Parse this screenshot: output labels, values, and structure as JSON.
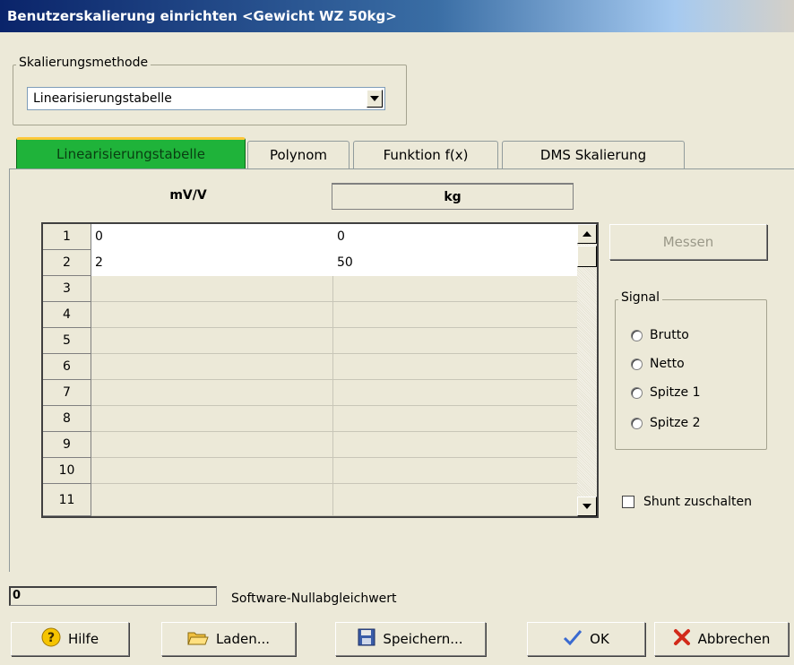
{
  "window": {
    "title": "Benutzerskalierung einrichten <Gewicht WZ 50kg>"
  },
  "method_group": {
    "label": "Skalierungsmethode",
    "selected": "Linearisierungstabelle"
  },
  "tabs": [
    {
      "label": "Linearisierungstabelle",
      "active": true
    },
    {
      "label": "Polynom",
      "active": false
    },
    {
      "label": "Funktion f(x)",
      "active": false
    },
    {
      "label": "DMS Skalierung",
      "active": false
    }
  ],
  "table": {
    "col1_header": "mV/V",
    "col2_header": "kg",
    "rows": [
      {
        "num": "1",
        "a": "0",
        "b": "0"
      },
      {
        "num": "2",
        "a": "2",
        "b": "50"
      },
      {
        "num": "3",
        "a": "",
        "b": ""
      },
      {
        "num": "4",
        "a": "",
        "b": ""
      },
      {
        "num": "5",
        "a": "",
        "b": ""
      },
      {
        "num": "6",
        "a": "",
        "b": ""
      },
      {
        "num": "7",
        "a": "",
        "b": ""
      },
      {
        "num": "8",
        "a": "",
        "b": ""
      },
      {
        "num": "9",
        "a": "",
        "b": ""
      },
      {
        "num": "10",
        "a": "",
        "b": ""
      },
      {
        "num": "11",
        "a": "",
        "b": ""
      }
    ]
  },
  "messen_label": "Messen",
  "signal": {
    "label": "Signal",
    "options": [
      "Brutto",
      "Netto",
      "Spitze 1",
      "Spitze 2"
    ]
  },
  "shunt_label": "Shunt zuschalten",
  "zero": {
    "value": "0",
    "label": "Software-Nullabgleichwert"
  },
  "buttons": {
    "hilfe": "Hilfe",
    "laden": "Laden...",
    "speichern": "Speichern...",
    "ok": "OK",
    "abbrechen": "Abbrechen"
  },
  "colors": {
    "active_tab": "#1fb33a",
    "title_start": "#0a246a"
  }
}
